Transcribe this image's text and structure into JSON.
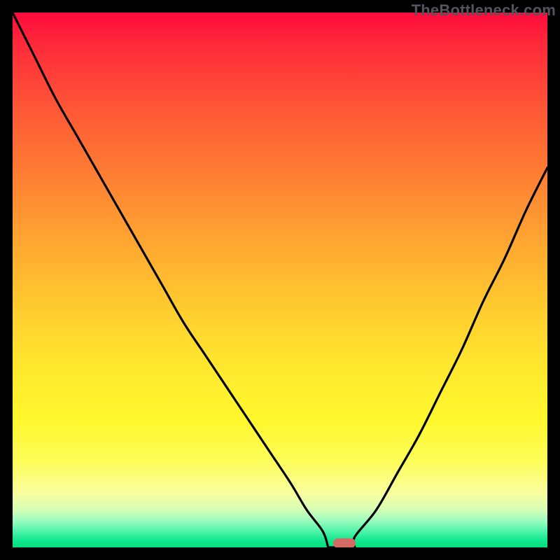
{
  "watermark": "TheBottleneck.com",
  "colors": {
    "curve": "#000000",
    "marker": "#d46a63",
    "frame": "#000000"
  },
  "chart_data": {
    "type": "line",
    "title": "",
    "xlabel": "",
    "ylabel": "",
    "xlim": [
      0,
      100
    ],
    "ylim": [
      0,
      100
    ],
    "grid": false,
    "legend": false,
    "series": [
      {
        "name": "bottleneck-curve",
        "x": [
          0,
          4,
          8,
          12,
          16,
          20,
          24,
          28,
          32,
          36,
          40,
          44,
          48,
          52,
          55,
          58,
          60,
          62,
          64,
          68,
          72,
          76,
          80,
          84,
          88,
          92,
          96,
          100
        ],
        "y": [
          100,
          92,
          84,
          77,
          70,
          63,
          56,
          49,
          42,
          36,
          30,
          24,
          18,
          12,
          7,
          3,
          1,
          0,
          2,
          7,
          14,
          21,
          29,
          37,
          46,
          54,
          63,
          71
        ]
      }
    ],
    "min_marker": {
      "x": 62,
      "y": 0
    },
    "floor": {
      "x_start": 59,
      "x_end": 64,
      "y": 0
    }
  }
}
